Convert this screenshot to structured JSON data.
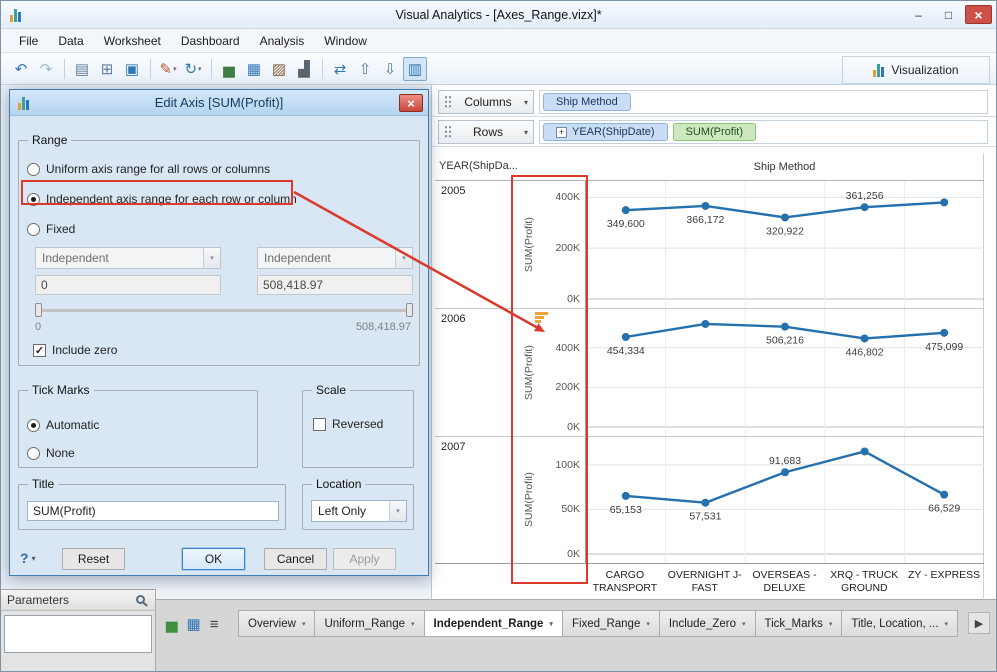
{
  "window": {
    "title": "Visual Analytics - [Axes_Range.vizx]*",
    "controls": [
      {
        "name": "minimize-button",
        "glyph": "–"
      },
      {
        "name": "maximize-button",
        "glyph": "□"
      },
      {
        "name": "close-button",
        "glyph": "×"
      }
    ]
  },
  "glyphs": {
    "caret": "▾",
    "check": "✓",
    "scroll_right": "▶"
  },
  "menu": {
    "items": [
      "File",
      "Data",
      "Worksheet",
      "Dashboard",
      "Analysis",
      "Window"
    ]
  },
  "toolbar": {
    "visualization_label": "Visualization",
    "icons": [
      {
        "name": "undo-icon",
        "glyph": "↶",
        "color": "#2e76b5"
      },
      {
        "name": "redo-icon",
        "glyph": "↷",
        "color": "#9db8d2"
      },
      {
        "sep": true
      },
      {
        "name": "new-worksheet-icon",
        "glyph": "▤",
        "color": "#5f7d9c"
      },
      {
        "name": "duplicate-worksheet-icon",
        "glyph": "⊞",
        "color": "#5f7d9c"
      },
      {
        "name": "save-icon",
        "glyph": "▣",
        "color": "#2e76b5"
      },
      {
        "sep": true
      },
      {
        "name": "format-painter-icon",
        "glyph": "✎",
        "color": "#b5542e",
        "dropdown": true
      },
      {
        "name": "refresh-icon",
        "glyph": "↻",
        "color": "#2e76b5",
        "dropdown": true
      },
      {
        "sep": true
      },
      {
        "name": "bar-chart-icon",
        "glyph": "▅",
        "color": "#3f7d46"
      },
      {
        "name": "grid-icon",
        "glyph": "▦",
        "color": "#2e76b5"
      },
      {
        "name": "combo-chart-icon",
        "glyph": "▨",
        "color": "#8a5a3a"
      },
      {
        "name": "histogram-icon",
        "glyph": "▟",
        "color": "#5a6570"
      },
      {
        "sep": true
      },
      {
        "name": "swap-axes-icon",
        "glyph": "⇄",
        "color": "#2e76b5"
      },
      {
        "name": "sort-ascending-icon",
        "glyph": "⇧",
        "color": "#4f7d9f"
      },
      {
        "name": "sort-descending-icon",
        "glyph": "⇩",
        "color": "#4f7d9f"
      },
      {
        "name": "edit-axes-icon",
        "glyph": "▥",
        "color": "#2e76b5",
        "selected": true
      }
    ]
  },
  "shelves": {
    "columns_label": "Columns",
    "rows_label": "Rows",
    "columns_pills": [
      {
        "label": "Ship Method",
        "type": "dimension"
      }
    ],
    "rows_pills": [
      {
        "label": "YEAR(ShipDate)",
        "type": "dimension",
        "expand": "+"
      },
      {
        "label": "SUM(Profit)",
        "type": "measure"
      }
    ]
  },
  "dialog": {
    "title": "Edit Axis [SUM(Profit)]",
    "range": {
      "legend": "Range",
      "options": [
        {
          "label": "Uniform axis range for all rows or columns",
          "selected": false
        },
        {
          "label": "Independent axis range for each row or column",
          "selected": true
        },
        {
          "label": "Fixed",
          "selected": false
        }
      ],
      "combo_left": "Independent",
      "combo_right": "Independent",
      "field_min": "0",
      "field_max": "508,418.97",
      "slider_min_label": "0",
      "slider_max_label": "508,418.97",
      "include_zero": {
        "label": "Include zero",
        "checked": true
      }
    },
    "tick_marks": {
      "legend": "Tick Marks",
      "options": [
        {
          "label": "Automatic",
          "selected": true
        },
        {
          "label": "None",
          "selected": false
        }
      ]
    },
    "scale": {
      "legend": "Scale",
      "reversed": {
        "label": "Reversed",
        "checked": false
      }
    },
    "title_group": {
      "legend": "Title",
      "value": "SUM(Profit)"
    },
    "location_group": {
      "legend": "Location",
      "value": "Left Only"
    },
    "help_label": "?",
    "buttons": [
      {
        "name": "reset-button",
        "label": "Reset"
      },
      {
        "name": "ok-button",
        "label": "OK",
        "primary": true
      },
      {
        "name": "cancel-button",
        "label": "Cancel"
      },
      {
        "name": "apply-button",
        "label": "Apply",
        "disabled": true
      }
    ]
  },
  "chart_data": {
    "type": "line",
    "col_header": "Ship Method",
    "row_header": "YEAR(ShipDa...",
    "ylabel": "SUM(Profit)",
    "line_color": "#2471ad",
    "categories": [
      "CARGO TRANSPORT",
      "OVERNIGHT J-FAST",
      "OVERSEAS - DELUXE",
      "XRQ - TRUCK GROUND",
      "ZY - EXPRESS"
    ],
    "category_lines": [
      [
        "CARGO",
        "TRANSPORT"
      ],
      [
        "OVERNIGHT J-",
        "FAST"
      ],
      [
        "OVERSEAS -",
        "DELUXE"
      ],
      [
        "XRQ - TRUCK",
        "GROUND"
      ],
      [
        "ZY - EXPRESS"
      ]
    ],
    "series": [
      {
        "name": "2005",
        "values": [
          349600,
          366172,
          320922,
          361256,
          380000
        ],
        "point_labels": [
          "349,600",
          "366,172",
          "320,922",
          "361,256",
          null
        ],
        "label_side": [
          "below",
          "below",
          "below",
          "above",
          null
        ],
        "axis_ticks": [
          {
            "value": 400000,
            "label": "400K"
          },
          {
            "value": 200000,
            "label": "200K"
          },
          {
            "value": 0,
            "label": "0K"
          }
        ],
        "axis_max": 425000
      },
      {
        "name": "2006",
        "values": [
          454334,
          520000,
          506216,
          446802,
          475099
        ],
        "point_labels": [
          "454,334",
          null,
          "506,216",
          "446,802",
          "475,099"
        ],
        "label_side": [
          "below",
          null,
          "below",
          "below",
          "below"
        ],
        "axis_ticks": [
          {
            "value": 400000,
            "label": "400K"
          },
          {
            "value": 200000,
            "label": "200K"
          },
          {
            "value": 0,
            "label": "0K"
          }
        ],
        "axis_max": 545000
      },
      {
        "name": "2007",
        "values": [
          65153,
          57531,
          91683,
          115000,
          66529
        ],
        "point_labels": [
          "65,153",
          "57,531",
          "91,683",
          null,
          "66,529"
        ],
        "label_side": [
          "below",
          "below",
          "above",
          null,
          "below"
        ],
        "axis_ticks": [
          {
            "value": 100000,
            "label": "100K"
          },
          {
            "value": 50000,
            "label": "50K"
          },
          {
            "value": 0,
            "label": "0K"
          }
        ],
        "axis_max": 120000
      }
    ]
  },
  "parameters": {
    "title": "Parameters"
  },
  "sheet_tabs": {
    "left_icons": [
      {
        "name": "sheet-sorter-icon",
        "glyph": "▅",
        "color": "#3f8f3f"
      },
      {
        "name": "grid-view-icon",
        "glyph": "▦",
        "color": "#2e76b5"
      },
      {
        "name": "list-view-icon",
        "glyph": "≡",
        "color": "#444444"
      }
    ],
    "tabs": [
      "Overview",
      "Uniform_Range",
      "Independent_Range",
      "Fixed_Range",
      "Include_Zero",
      "Tick_Marks",
      "Title, Location, ..."
    ],
    "active": "Independent_Range"
  }
}
